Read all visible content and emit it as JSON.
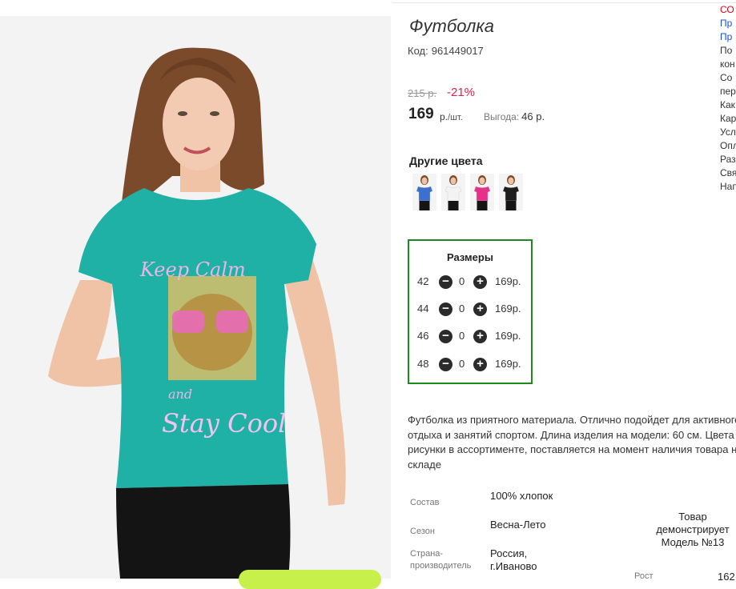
{
  "product": {
    "title": "Футболка",
    "sku_label": "Код:",
    "sku": "961449017",
    "old_price": "215 р.",
    "discount": "-21%",
    "price": "169",
    "price_unit": "р.",
    "price_per": "/шт.",
    "benefit_label": "Выгода:",
    "benefit_value": "46 р."
  },
  "image": {
    "print_text_top": "Keep Calm",
    "print_text_and": "and",
    "print_text_bottom": "Stay Cool"
  },
  "colors": {
    "title": "Другие цвета",
    "swatches": [
      {
        "name": "blue",
        "color": "#3b6fd0"
      },
      {
        "name": "white",
        "color": "#f3f3f3"
      },
      {
        "name": "pink",
        "color": "#e8308a"
      },
      {
        "name": "black",
        "color": "#1e1e1e"
      }
    ]
  },
  "sizes": {
    "title": "Размеры",
    "rows": [
      {
        "size": "42",
        "qty": "0",
        "price": "169р."
      },
      {
        "size": "44",
        "qty": "0",
        "price": "169р."
      },
      {
        "size": "46",
        "qty": "0",
        "price": "169р."
      },
      {
        "size": "48",
        "qty": "0",
        "price": "169р."
      }
    ]
  },
  "description": "Футболка из приятного материала. Отлично подойдет для активного отдыха и занятий спортом. Длина изделия на модели: 60 см. Цвета и рисунки в ассортименте, поставляется на момент наличия товара на складе",
  "properties": [
    {
      "label": "Состав",
      "value": "100% хлопок"
    },
    {
      "label": "Сезон",
      "value": "Весна-Лето"
    },
    {
      "label": "Страна-производитель",
      "value": "Россия, г.Иваново"
    }
  ],
  "model_note": "Товар демонстрирует Модель №13",
  "model_height_label": "Рост",
  "model_height_value": "162",
  "sidebar": [
    {
      "text": "СО",
      "style": "red"
    },
    {
      "text": "Пр",
      "style": "link"
    },
    {
      "text": "Пр",
      "style": "link"
    },
    {
      "text": "По",
      "style": "plain"
    },
    {
      "text": "кон",
      "style": "plain"
    },
    {
      "text": "Со",
      "style": "plain"
    },
    {
      "text": "пер",
      "style": "plain"
    },
    {
      "text": "Как",
      "style": "plain"
    },
    {
      "text": "Кар",
      "style": "plain"
    },
    {
      "text": "Усл",
      "style": "plain"
    },
    {
      "text": "Опл",
      "style": "plain"
    },
    {
      "text": "Раз",
      "style": "plain"
    },
    {
      "text": "Свя",
      "style": "plain"
    },
    {
      "text": "Нап",
      "style": "plain"
    }
  ],
  "theme": {
    "accent_green": "#1d8a1d",
    "discount_red": "#e0214a",
    "shirt_teal": "#1fb0a6",
    "button_lime": "#c7f04a"
  }
}
